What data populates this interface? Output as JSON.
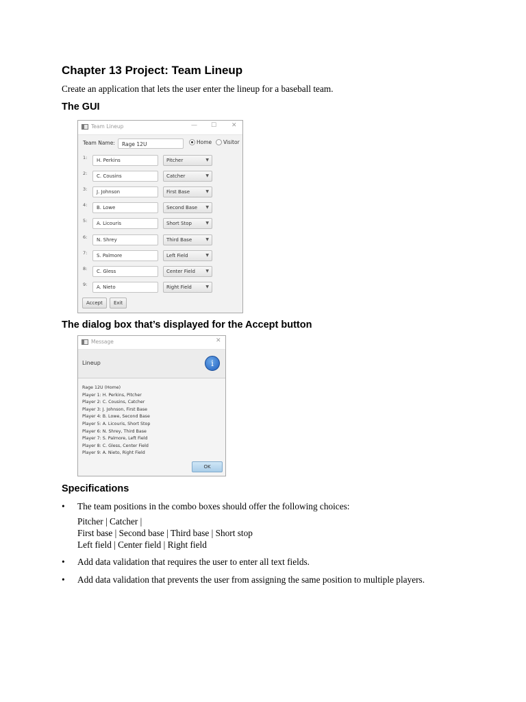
{
  "doc": {
    "title": "Chapter 13 Project: Team Lineup",
    "intro": "Create an application that lets the user enter the lineup for a baseball team.",
    "gui_heading": "The GUI",
    "dialog_heading": "The dialog box that’s displayed for the Accept button",
    "spec_heading": "Specifications",
    "bullet_symbol": "•",
    "bullets": [
      "The team positions in the combo boxes should offer the following choices:",
      "Add data validation that requires the user to enter all text fields.",
      "Add data validation that prevents the user from assigning the same position to multiple players."
    ],
    "choices": [
      "Pitcher | Catcher |",
      "First base | Second base | Third base | Short stop",
      "Left field | Center field | Right field"
    ]
  },
  "window": {
    "title": "Team Lineup",
    "minimize_glyph": "—",
    "maximize_glyph": "☐",
    "close_glyph": "✕",
    "team_label": "Team Name:",
    "team_value": "Rage 12U",
    "radio_home": "Home",
    "radio_visitor": "Visitor",
    "selected_radio": "Home",
    "dropdown_arrow": "▼",
    "players": [
      {
        "num": "1:",
        "name": "H. Perkins",
        "position": "Pitcher"
      },
      {
        "num": "2:",
        "name": "C. Cousins",
        "position": "Catcher"
      },
      {
        "num": "3:",
        "name": "J. Johnson",
        "position": "First Base"
      },
      {
        "num": "4:",
        "name": "B. Lowe",
        "position": "Second Base"
      },
      {
        "num": "5:",
        "name": "A. Licouris",
        "position": "Short Stop"
      },
      {
        "num": "6:",
        "name": "N. Shrey",
        "position": "Third Base"
      },
      {
        "num": "7:",
        "name": "S. Palmore",
        "position": "Left Field"
      },
      {
        "num": "8:",
        "name": "C. Gless",
        "position": "Center Field"
      },
      {
        "num": "9:",
        "name": "A. Nieto",
        "position": "Right Field"
      }
    ],
    "accept_label": "Accept",
    "exit_label": "Exit"
  },
  "dialog": {
    "title": "Message",
    "close_glyph": "✕",
    "header": "Lineup",
    "info_glyph": "i",
    "lines": [
      "Rage 12U (Home)",
      "Player 1: H. Perkins, Pitcher",
      "Player 2: C. Cousins, Catcher",
      "Player 3: J. Johnson, First Base",
      "Player 4: B. Lowe, Second Base",
      "Player 5: A. Licouris, Short Stop",
      "Player 6: N. Shrey, Third Base",
      "Player 7: S. Palmore, Left Field",
      "Player 8: C. Gless, Center Field",
      "Player 9: A. Nieto, Right Field"
    ],
    "ok_label": "OK"
  }
}
